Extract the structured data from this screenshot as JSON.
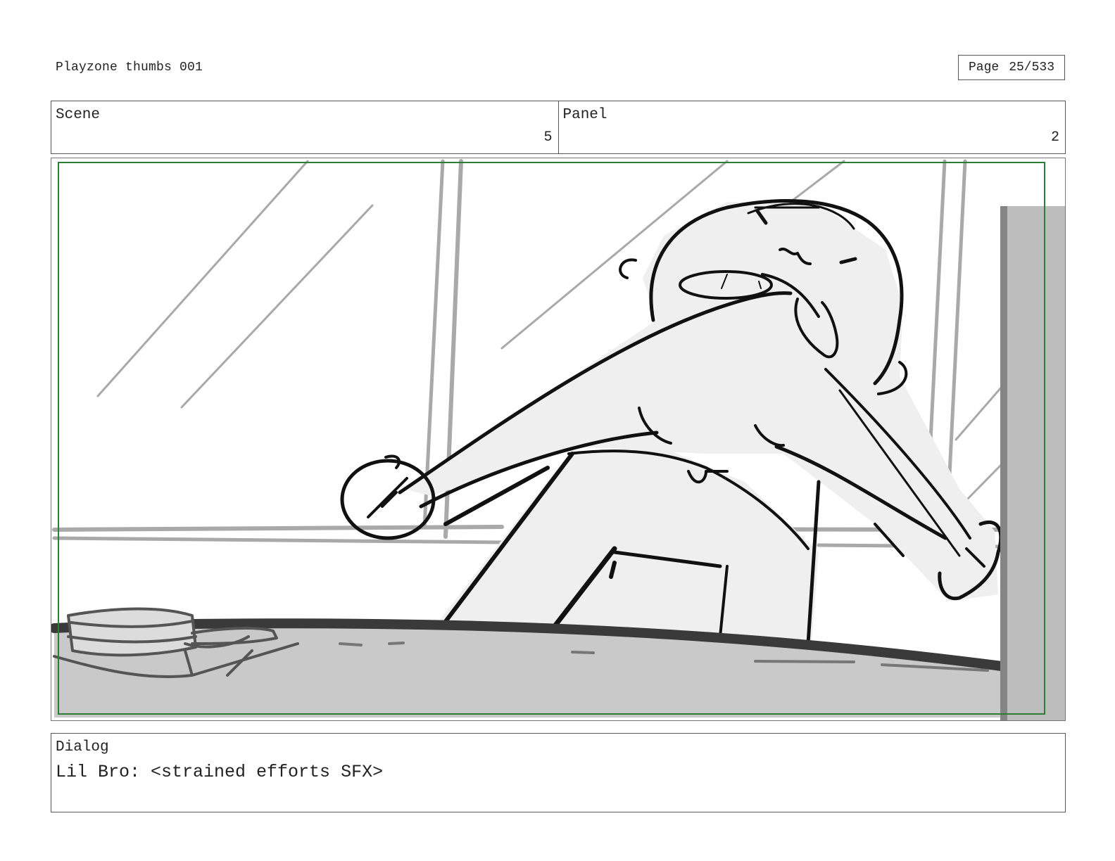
{
  "header": {
    "title": "Playzone thumbs 001",
    "page_label": "Page",
    "page_value": "25/533"
  },
  "info": {
    "scene_label": "Scene",
    "scene_value": "5",
    "panel_label": "Panel",
    "panel_value": "2"
  },
  "dialog": {
    "label": "Dialog",
    "text": "Lil Bro: <strained efforts SFX>"
  },
  "colors": {
    "safe_frame": "#2e7d32",
    "sketch_line": "#111111",
    "fill_light": "#efefef",
    "fill_table": "#c9c9c9",
    "guide_gray": "#a9a9a9"
  }
}
